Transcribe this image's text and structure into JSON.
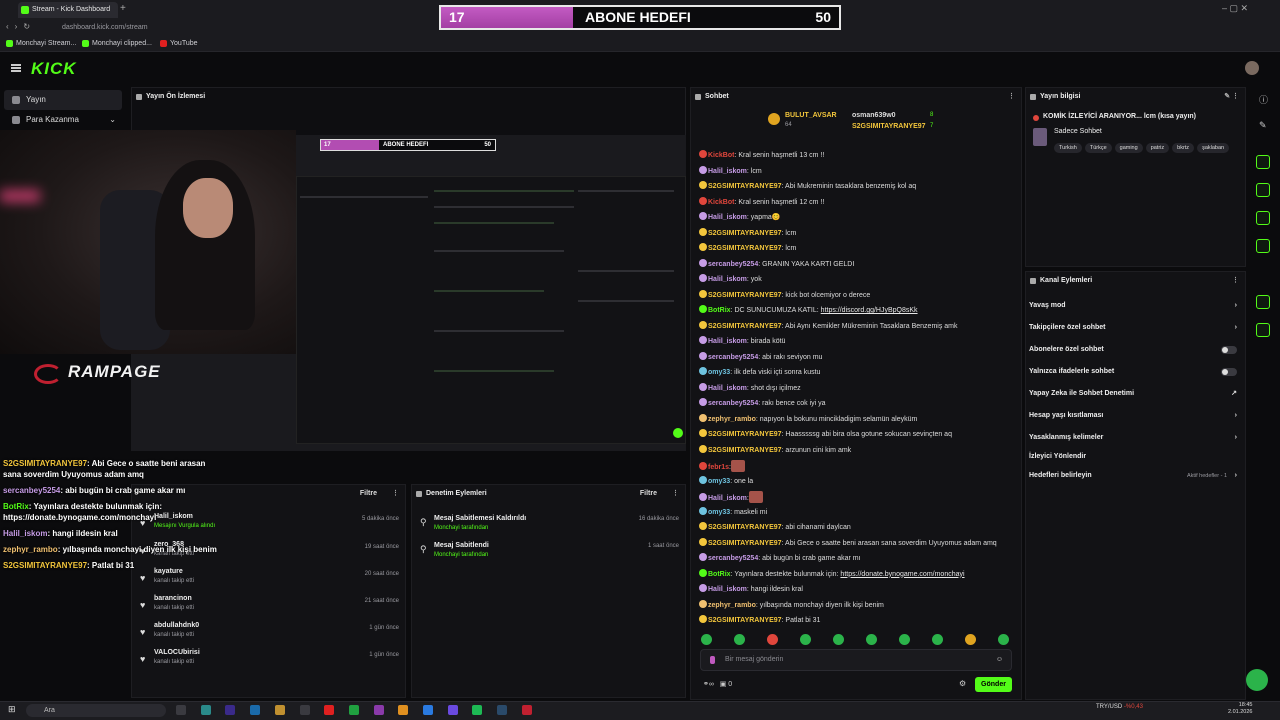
{
  "browser": {
    "tab_title": "Stream - Kick Dashboard",
    "url": "dashboard.kick.com/stream",
    "bookmarks": [
      "Monchayi Stream...",
      "Monchayi clipped...",
      "YouTube"
    ]
  },
  "goal": {
    "current": "17",
    "title": "ABONE HEDEFI",
    "target": "50",
    "progress_fraction": 0.34
  },
  "header": {
    "logo": "KICK"
  },
  "nav": {
    "items": [
      {
        "label": "Yayın"
      },
      {
        "label": "Para Kazanma"
      }
    ]
  },
  "preview": {
    "title": "Yayın Ön İzlemesi",
    "overlay_brand": "RAMPAGE",
    "mini_goal": {
      "current": "17",
      "title": "ABONE HEDEFI",
      "target": "50"
    }
  },
  "overlay_chat": [
    {
      "user": "S2GSIMITAYRANYE97",
      "text": ": Abi Gece o saatte beni arasan"
    },
    {
      "user": "",
      "text": "sana soverdim Uyuyomus adam amq"
    },
    {
      "user": "sercanbey5254",
      "text": ": abi bugün bi crab game akar mı"
    },
    {
      "user": "BotRix",
      "text": ": Yayınlara destekte bulunmak için:"
    },
    {
      "user": "",
      "text": "https://donate.bynogame.com/monchayi"
    },
    {
      "user": "Halil_iskom",
      "text": ": hangi ildesin kral"
    },
    {
      "user": "zephyr_rambo",
      "text": ": yılbaşında monchayi diyen ilk kişi benim"
    },
    {
      "user": "S2GSIMITAYRANYE97",
      "text": ": Patlat bi 31"
    }
  ],
  "followers_panel": {
    "filter_label": "Filtre",
    "rows": [
      {
        "name": "Halil_iskom",
        "sub": "Mesajını Vurgula alındı",
        "time": "5 dakika önce"
      },
      {
        "name": "zero_368",
        "sub": "kanalı takip etti",
        "time": "19 saat önce"
      },
      {
        "name": "kayature",
        "sub": "kanalı takip etti",
        "time": "20 saat önce"
      },
      {
        "name": "barancinon",
        "sub": "kanalı takip etti",
        "time": "21 saat önce"
      },
      {
        "name": "abdullahdnk0",
        "sub": "kanalı takip etti",
        "time": "1 gün önce"
      },
      {
        "name": "VALOCUbirisi",
        "sub": "kanalı takip etti",
        "time": "1 gün önce"
      }
    ]
  },
  "audit_panel": {
    "title": "Denetim Eylemleri",
    "filter_label": "Filtre",
    "rows": [
      {
        "name": "Mesaj Sabitlemesi Kaldırıldı",
        "sub": "Monchayi tarafından",
        "time": "16 dakika önce"
      },
      {
        "name": "Mesaj Sabitlendi",
        "sub": "Monchayi tarafından",
        "time": "1 saat önce"
      }
    ]
  },
  "chat": {
    "title": "Sohbet",
    "pinned": {
      "user1": "BULUT_AVSAR",
      "count1": "64",
      "user2": "osman639w0",
      "count2": "8",
      "user3": "S2GSIMITAYRANYE97",
      "count3": "7"
    },
    "messages": [
      {
        "user": "KickBot",
        "color": "#e0463c",
        "text": ": Kral senin haşmetli 13 cm !!"
      },
      {
        "user": "Halil_iskom",
        "color": "#c69ce6",
        "text": ": lcm"
      },
      {
        "user": "S2GSIMITAYRANYE97",
        "color": "#f3c63c",
        "text": ": Abi Mukreminin tasaklara benzemiş kol aq"
      },
      {
        "user": "KickBot",
        "color": "#e0463c",
        "text": ": Kral senin haşmetli 12 cm !!"
      },
      {
        "user": "Halil_iskom",
        "color": "#c69ce6",
        "text": ": yapma😊"
      },
      {
        "user": "S2GSIMITAYRANYE97",
        "color": "#f3c63c",
        "text": ": lcm"
      },
      {
        "user": "S2GSIMITAYRANYE97",
        "color": "#f3c63c",
        "text": ": lcm"
      },
      {
        "user": "sercanbey5254",
        "color": "#c69ce6",
        "text": ": GRANIN YAKA KARTI GELDI"
      },
      {
        "user": "Halil_iskom",
        "color": "#c69ce6",
        "text": ": yok"
      },
      {
        "user": "S2GSIMITAYRANYE97",
        "color": "#f3c63c",
        "text": ": kick bot olcemiyor o derece"
      },
      {
        "user": "BotRix",
        "color": "#53fc18",
        "text": ": DC SUNUCUMUZA KATIL: ",
        "link": "https://discord.gg/HJyBpQ8sKk"
      },
      {
        "user": "S2GSIMITAYRANYE97",
        "color": "#f3c63c",
        "text": ": Abi Aynı Kemikler Mükreminin Tasaklara Benzemiş amk"
      },
      {
        "user": "Halil_iskom",
        "color": "#c69ce6",
        "text": ": birada kötü"
      },
      {
        "user": "sercanbey5254",
        "color": "#c69ce6",
        "text": ": abi rakı seviyon mu"
      },
      {
        "user": "omy33",
        "color": "#6ec3e0",
        "text": ": ilk defa viski içti sonra kustu"
      },
      {
        "user": "Halil_iskom",
        "color": "#c69ce6",
        "text": ": shot dışı içilmez"
      },
      {
        "user": "sercanbey5254",
        "color": "#c69ce6",
        "text": ": rakı bence cok iyi ya"
      },
      {
        "user": "zephyr_rambo",
        "color": "#f0c070",
        "text": ": napıyon la bokunu mincikladigim selamün aleyküm"
      },
      {
        "user": "S2GSIMITAYRANYE97",
        "color": "#f3c63c",
        "text": ": Haasssssg abi bira olsa gotune sokucan sevinçten aq"
      },
      {
        "user": "S2GSIMITAYRANYE97",
        "color": "#f3c63c",
        "text": ": arzunun cini kim amk"
      },
      {
        "user": "febr1s",
        "color": "#e0463c",
        "text": ":",
        "emote": true
      },
      {
        "user": "omy33",
        "color": "#6ec3e0",
        "text": ": one la"
      },
      {
        "user": "Halil_iskom",
        "color": "#c69ce6",
        "text": ":",
        "emote": true
      },
      {
        "user": "omy33",
        "color": "#6ec3e0",
        "text": ": maskeli mi"
      },
      {
        "user": "S2GSIMITAYRANYE97",
        "color": "#f3c63c",
        "text": ": abi cihanami daylcan"
      },
      {
        "user": "S2GSIMITAYRANYE97",
        "color": "#f3c63c",
        "text": ": Abi Gece o saatte beni arasan sana soverdim Uyuyomus adam amq"
      },
      {
        "user": "sercanbey5254",
        "color": "#c69ce6",
        "text": ": abi bugün bi crab game akar mı"
      },
      {
        "user": "BotRix",
        "color": "#53fc18",
        "text": ": Yayınlara destekte bulunmak için: ",
        "link": "https://donate.bynogame.com/monchayi"
      },
      {
        "user": "Halil_iskom",
        "color": "#c69ce6",
        "text": ": hangi ildesin kral"
      },
      {
        "user": "zephyr_rambo",
        "color": "#f0c070",
        "text": ": yılbaşında monchayi diyen ilk kişi benim"
      },
      {
        "user": "S2GSIMITAYRANYE97",
        "color": "#f3c63c",
        "text": ": Patlat bi 31"
      }
    ],
    "input_placeholder": "Bir mesaj gönderin",
    "send_label": "Gönder",
    "points": "0"
  },
  "stream_info": {
    "title": "Yayın bilgisi",
    "stream_title": "KOMİK İZLEYİCİ ARANIYOR... lcm (kısa yayın)",
    "category": "Sadece Sohbet",
    "tags": [
      "Turkish",
      "Türkçe",
      "gaming",
      "patriz",
      "bkrtz",
      "şaklaban"
    ]
  },
  "channel_actions": {
    "title": "Kanal Eylemleri",
    "items": [
      {
        "label": "Yavaş mod",
        "control": "chevron"
      },
      {
        "label": "Takipçilere özel sohbet",
        "control": "chevron"
      },
      {
        "label": "Abonelere özel sohbet",
        "control": "toggle"
      },
      {
        "label": "Yalnızca ifadelerle sohbet",
        "control": "toggle"
      },
      {
        "label": "Yapay Zeka ile Sohbet Denetimi",
        "control": "external"
      },
      {
        "label": "Hesap yaşı kısıtlaması",
        "control": "chevron"
      },
      {
        "label": "Yasaklanmış kelimeler",
        "control": "chevron"
      },
      {
        "label": "İzleyici Yönlendir",
        "control": "none"
      },
      {
        "label": "Hedefleri belirleyin",
        "control": "chevron",
        "extra": "Aktif hedefler - 1"
      }
    ]
  },
  "taskbar": {
    "search_placeholder": "Ara",
    "currency": "TRY/USD",
    "currency_change": "-%0,43",
    "time": "18:45",
    "date": "2.01.2026"
  },
  "colors": {
    "accent": "#53fc18",
    "goal_fill": "#b24db2",
    "bg": "#0b0b0d",
    "panel": "#121215"
  }
}
